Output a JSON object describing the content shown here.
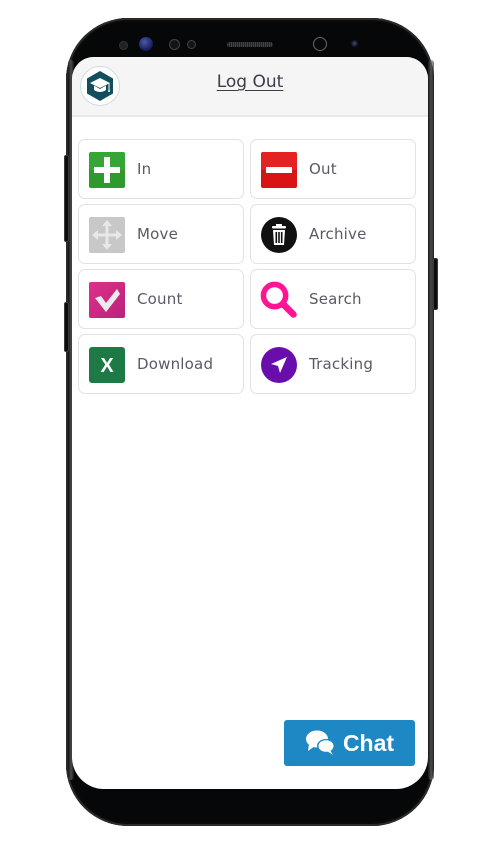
{
  "header": {
    "logo_icon": "graduation-cap-cube-icon",
    "logout_label": "Log Out"
  },
  "tiles": [
    {
      "label": "In",
      "icon": "plus-icon",
      "color": "#2e9a2e"
    },
    {
      "label": "Out",
      "icon": "minus-icon",
      "color": "#d81414"
    },
    {
      "label": "Move",
      "icon": "move-arrows-icon",
      "color": "#c8c8c8"
    },
    {
      "label": "Archive",
      "icon": "trash-icon",
      "color": "#111111"
    },
    {
      "label": "Count",
      "icon": "checkmark-icon",
      "color": "#d63384"
    },
    {
      "label": "Search",
      "icon": "magnifier-icon",
      "color": "#ff1493"
    },
    {
      "label": "Download",
      "icon": "excel-icon",
      "color": "#1d7a45"
    },
    {
      "label": "Tracking",
      "icon": "navigation-arrow-icon",
      "color": "#6a0dad"
    }
  ],
  "chat": {
    "label": "Chat",
    "icon": "chat-bubbles-icon",
    "color": "#1e88c4"
  }
}
